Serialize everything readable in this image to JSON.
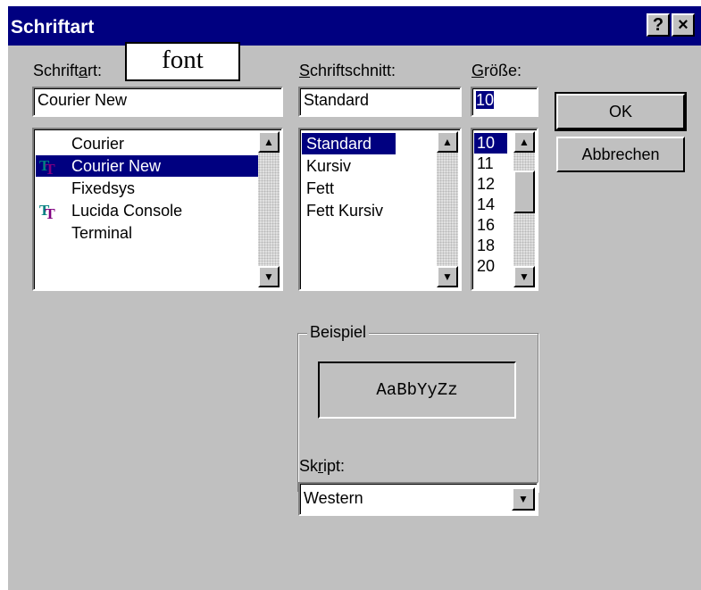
{
  "window": {
    "title": "Schriftart",
    "help_glyph": "?",
    "close_glyph": "×",
    "annotation": "font"
  },
  "font": {
    "label_pre": "Schrift",
    "label_accel": "a",
    "label_post": "rt:",
    "value": "Courier New",
    "items": [
      {
        "name": "Courier",
        "icon": ""
      },
      {
        "name": "Courier New",
        "icon": "truetype-icon",
        "selected": true
      },
      {
        "name": "Fixedsys",
        "icon": ""
      },
      {
        "name": "Lucida Console",
        "icon": "truetype-icon"
      },
      {
        "name": "Terminal",
        "icon": ""
      }
    ]
  },
  "style": {
    "label_accel": "S",
    "label_post": "chriftschnitt:",
    "value": "Standard",
    "items": [
      "Standard",
      "Kursiv",
      "Fett",
      "Fett Kursiv"
    ]
  },
  "size": {
    "label_accel": "G",
    "label_post": "röße:",
    "value": "10",
    "items": [
      "10",
      "11",
      "12",
      "14",
      "16",
      "18",
      "20"
    ]
  },
  "buttons": {
    "ok": "OK",
    "cancel": "Abbrechen"
  },
  "sample": {
    "label": "Beispiel",
    "text": "AaBbYyZz"
  },
  "script": {
    "label_pre": "Sk",
    "label_accel": "r",
    "label_post": "ipt:",
    "value": "Western"
  },
  "colors": {
    "titlebar": "#000080",
    "face": "#c0c0c0",
    "selection": "#000080",
    "truetype_1": "#008080",
    "truetype_2": "#800080"
  }
}
